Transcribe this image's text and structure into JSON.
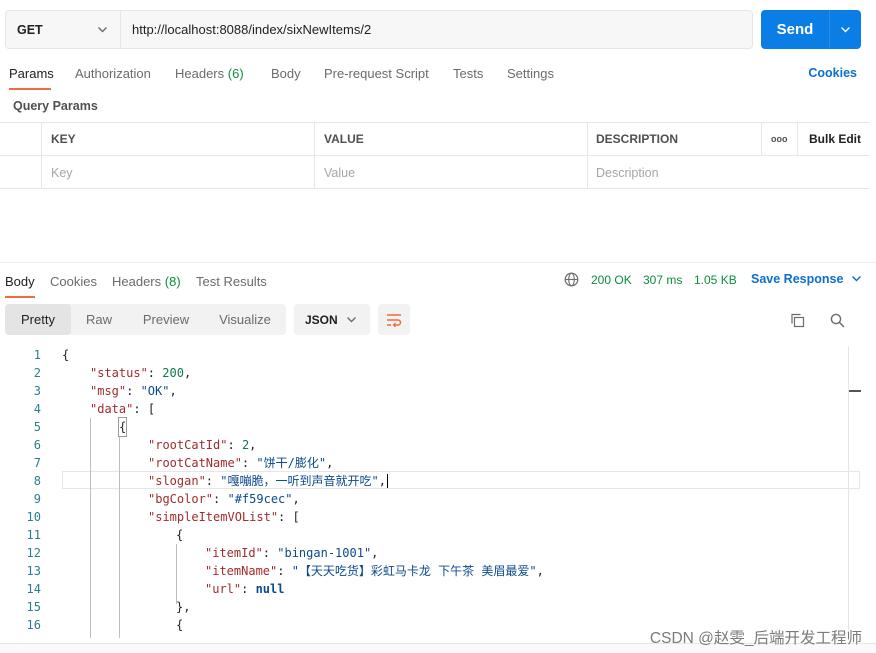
{
  "request": {
    "method": "GET",
    "url": "http://localhost:8088/index/sixNewItems/2",
    "send_label": "Send"
  },
  "request_tabs": {
    "params": "Params",
    "authorization": "Authorization",
    "headers": "Headers",
    "headers_count": "(6)",
    "body": "Body",
    "prerequest": "Pre-request Script",
    "tests": "Tests",
    "settings": "Settings",
    "cookies": "Cookies"
  },
  "query_params": {
    "title": "Query Params",
    "headers": {
      "key": "KEY",
      "value": "VALUE",
      "description": "DESCRIPTION",
      "more": "ooo",
      "bulk_edit": "Bulk Edit"
    },
    "placeholders": {
      "key": "Key",
      "value": "Value",
      "description": "Description"
    }
  },
  "response": {
    "tabs": {
      "body": "Body",
      "cookies": "Cookies",
      "headers": "Headers",
      "headers_count": "(8)",
      "test_results": "Test Results"
    },
    "status": "200 OK",
    "time": "307 ms",
    "size": "1.05 KB",
    "save_label": "Save Response",
    "view_modes": [
      "Pretty",
      "Raw",
      "Preview",
      "Visualize"
    ],
    "format": "JSON"
  },
  "code_lines": [
    {
      "n": "1"
    },
    {
      "n": "2",
      "key": "\"status\"",
      "num": "200"
    },
    {
      "n": "3",
      "key": "\"msg\"",
      "str": "\"OK\""
    },
    {
      "n": "4",
      "key": "\"data\"",
      "open": "["
    },
    {
      "n": "5",
      "open": "{"
    },
    {
      "n": "6",
      "key": "\"rootCatId\"",
      "num": "2"
    },
    {
      "n": "7",
      "key": "\"rootCatName\"",
      "str": "\"饼干/膨化\""
    },
    {
      "n": "8",
      "key": "\"slogan\"",
      "str": "\"嘎嘣脆，一听到声音就开吃\""
    },
    {
      "n": "9",
      "key": "\"bgColor\"",
      "str": "\"#f59cec\""
    },
    {
      "n": "10",
      "key": "\"simpleItemVOList\"",
      "open": "["
    },
    {
      "n": "11",
      "open": "{"
    },
    {
      "n": "12",
      "key": "\"itemId\"",
      "str": "\"bingan-1001\""
    },
    {
      "n": "13",
      "key": "\"itemName\"",
      "str": "\"【天天吃货】彩虹马卡龙 下午茶 美眉最爱\""
    },
    {
      "n": "14",
      "key": "\"url\"",
      "null": "null"
    },
    {
      "n": "15",
      "close": "},"
    },
    {
      "n": "16",
      "open": "{"
    }
  ],
  "watermark": "CSDN @赵雯_后端开发工程师",
  "colors": {
    "accent": "#f26b3a",
    "send": "#0b7ee6",
    "status_ok": "#0f8c3c",
    "link": "#0b6fd1"
  },
  "icons": [
    "chevron-down-icon",
    "globe-icon",
    "wrap-lines-icon",
    "copy-icon",
    "search-icon"
  ]
}
